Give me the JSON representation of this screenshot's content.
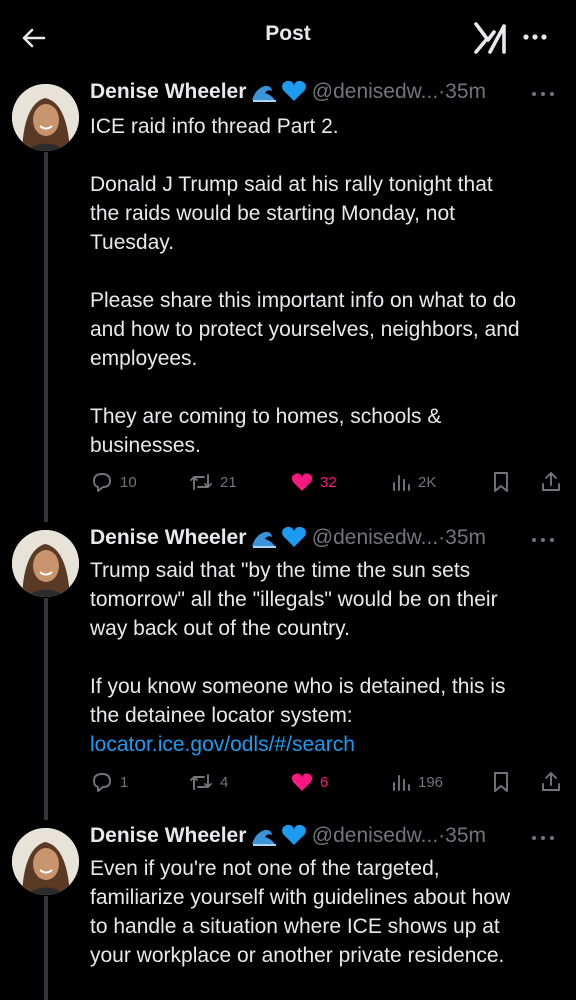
{
  "header": {
    "title": "Post"
  },
  "posts": [
    {
      "author": "Denise Wheeler",
      "handle": "@denisedw...",
      "time": "·35m",
      "lines": [
        "ICE raid info thread Part 2.",
        "",
        "Donald J Trump said at his rally tonight that",
        "the raids would be starting Monday, not",
        "Tuesday.",
        "",
        "Please share this important info on what to do",
        "and how to protect yourselves, neighbors, and",
        "employees.",
        "",
        "They are coming to homes, schools &",
        "businesses."
      ],
      "replies": "10",
      "reposts": "21",
      "likes": "32",
      "views": "2K"
    },
    {
      "author": "Denise Wheeler",
      "handle": "@denisedw...",
      "time": "·35m",
      "lines": [
        "Trump said that \"by the time the sun sets",
        "tomorrow\" all the \"illegals\" would be on their",
        "way back out of the country.",
        "",
        "If you know someone who is detained, this is",
        "the detainee locator system:"
      ],
      "link": "locator.ice.gov/odls/#/search",
      "replies": "1",
      "reposts": "4",
      "likes": "6",
      "views": "196"
    },
    {
      "author": "Denise Wheeler",
      "handle": "@denisedw...",
      "time": "·35m",
      "lines": [
        "Even if you're not one of the targeted,",
        "familiarize yourself with guidelines about how",
        "to handle a situation where ICE shows up at",
        "your workplace or another private residence."
      ]
    }
  ],
  "colors": {
    "like": "#f91880",
    "link": "#1d9bf0",
    "muted": "#71767b",
    "heart_emoji": "#1d9bf0"
  }
}
